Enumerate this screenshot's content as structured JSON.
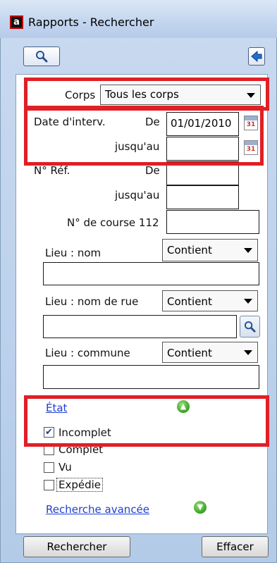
{
  "window": {
    "title": "Rapports - Rechercher",
    "app_icon_letter": "a"
  },
  "toolbar": {
    "search_icon": "magnifier-icon",
    "back_icon": "arrow-left-icon"
  },
  "form": {
    "corps_label": "Corps",
    "corps_value": "Tous les corps",
    "date_label": "Date d'interv.",
    "de_label": "De",
    "date_from": "01/01/2010",
    "jusquau_label": "jusqu'au",
    "date_to": "",
    "ref_label": "N° Réf.",
    "ref_de_label": "De",
    "ref_from": "",
    "ref_jusquau_label": "jusqu'au",
    "ref_to": "",
    "course_label": "N° de course 112",
    "course_value": "",
    "lieu_nom_label": "Lieu : nom",
    "lieu_nom_mode": "Contient",
    "lieu_nom_value": "",
    "lieu_rue_label": "Lieu : nom de rue",
    "lieu_rue_mode": "Contient",
    "lieu_rue_value": "",
    "lieu_commune_label": "Lieu : commune",
    "lieu_commune_mode": "Contient",
    "lieu_commune_value": "",
    "calendar_day": "31"
  },
  "etat": {
    "title": "État",
    "options": [
      {
        "label": "Incomplet",
        "checked": true
      },
      {
        "label": "Complet",
        "checked": false
      },
      {
        "label": "Vu",
        "checked": false
      },
      {
        "label": "Expédie",
        "checked": false
      }
    ],
    "advanced_link": "Recherche avancée"
  },
  "buttons": {
    "search": "Rechercher",
    "clear": "Effacer"
  },
  "colors": {
    "highlight": "#e01f26",
    "link": "#1f3fcf",
    "frame": "#b3cbe8"
  }
}
